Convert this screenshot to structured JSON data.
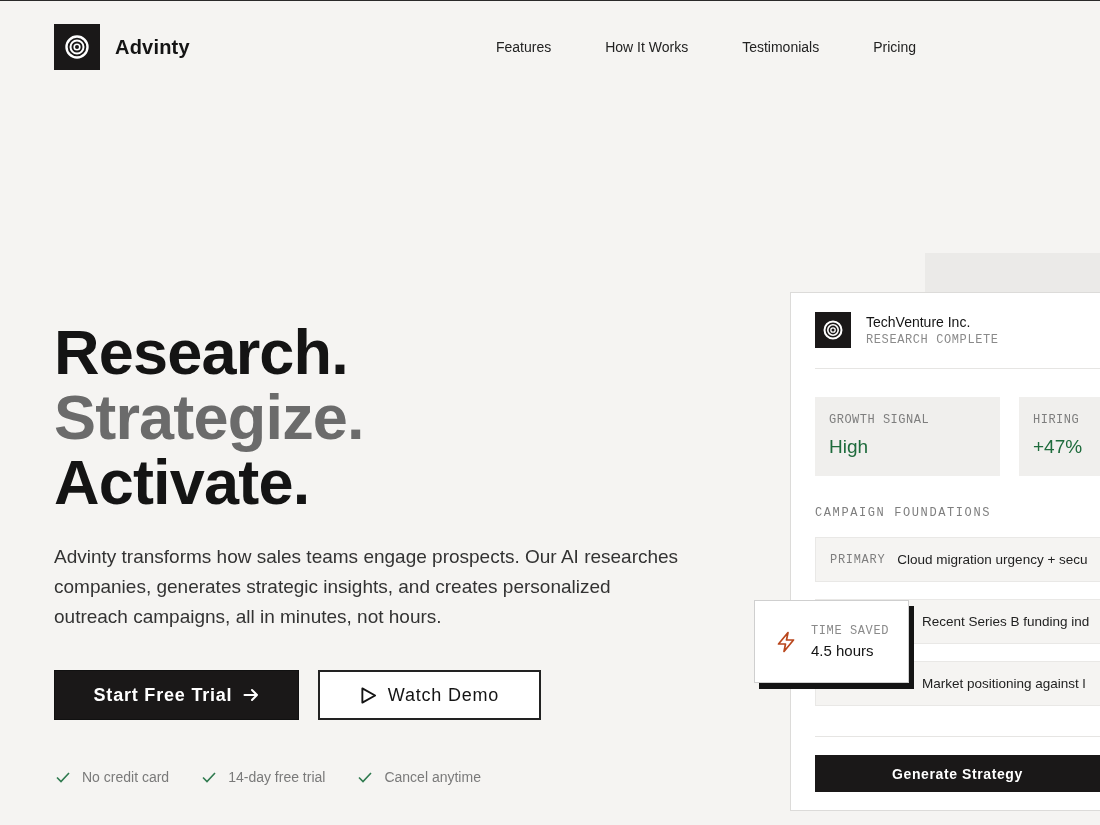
{
  "header": {
    "brand": "Advinty",
    "nav": [
      "Features",
      "How It Works",
      "Testimonials",
      "Pricing"
    ]
  },
  "hero": {
    "headline": [
      {
        "text": "Research.",
        "color": "#141414"
      },
      {
        "text": "Strategize.",
        "color": "#6b6b6b"
      },
      {
        "text": "Activate.",
        "color": "#141414"
      }
    ],
    "description": "Advinty transforms how sales teams engage prospects. Our AI researches companies, generates strategic insights, and creates personalized outreach campaigns, all in minutes, not hours.",
    "buttons": [
      {
        "kind": "primary",
        "label": "Start Free Trial"
      },
      {
        "kind": "outline",
        "label": "Watch Demo"
      }
    ],
    "perks": [
      "No credit card",
      "14-day free trial",
      "Cancel anytime"
    ]
  },
  "preview_card": {
    "company": "TechVenture Inc.",
    "status": "RESEARCH COMPLETE",
    "metrics": [
      {
        "label": "GROWTH SIGNAL",
        "value": "High"
      },
      {
        "label": "HIRING",
        "value": "+47%"
      }
    ],
    "section_label": "CAMPAIGN FOUNDATIONS",
    "foundations": [
      {
        "label": "PRIMARY",
        "text": "Cloud migration urgency + secu"
      },
      {
        "text": "Recent Series B funding ind"
      },
      {
        "text": "Market positioning against l"
      }
    ],
    "button": "Generate Strategy"
  },
  "time_saved": {
    "label": "TIME SAVED",
    "value": "4.5 hours"
  }
}
